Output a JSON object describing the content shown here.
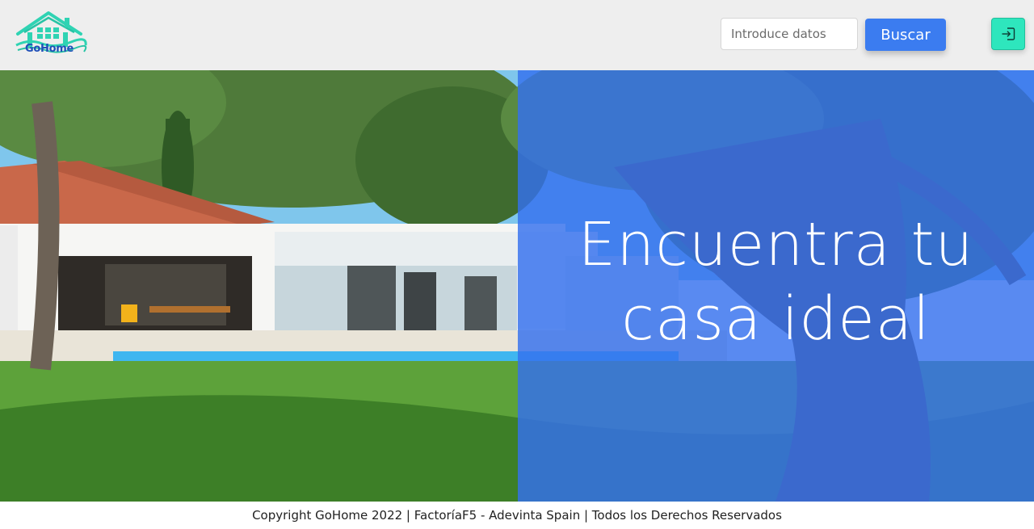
{
  "brand": {
    "name": "GoHome"
  },
  "header": {
    "search": {
      "placeholder": "Introduce datos",
      "value": ""
    },
    "search_button_label": "Buscar",
    "login_icon": "login-icon"
  },
  "hero": {
    "heading": "Encuentra tu casa ideal",
    "overlay_color": "#3470ee"
  },
  "footer": {
    "text": "Copyright GoHome 2022 | FactoríaF5 - Adevinta Spain | Todos los Derechos Reservados"
  },
  "colors": {
    "header_bg": "#eeeeee",
    "accent": "#3b7cf0",
    "login_bg": "#2ee6bd",
    "logo_teal": "#2fd3b3"
  }
}
